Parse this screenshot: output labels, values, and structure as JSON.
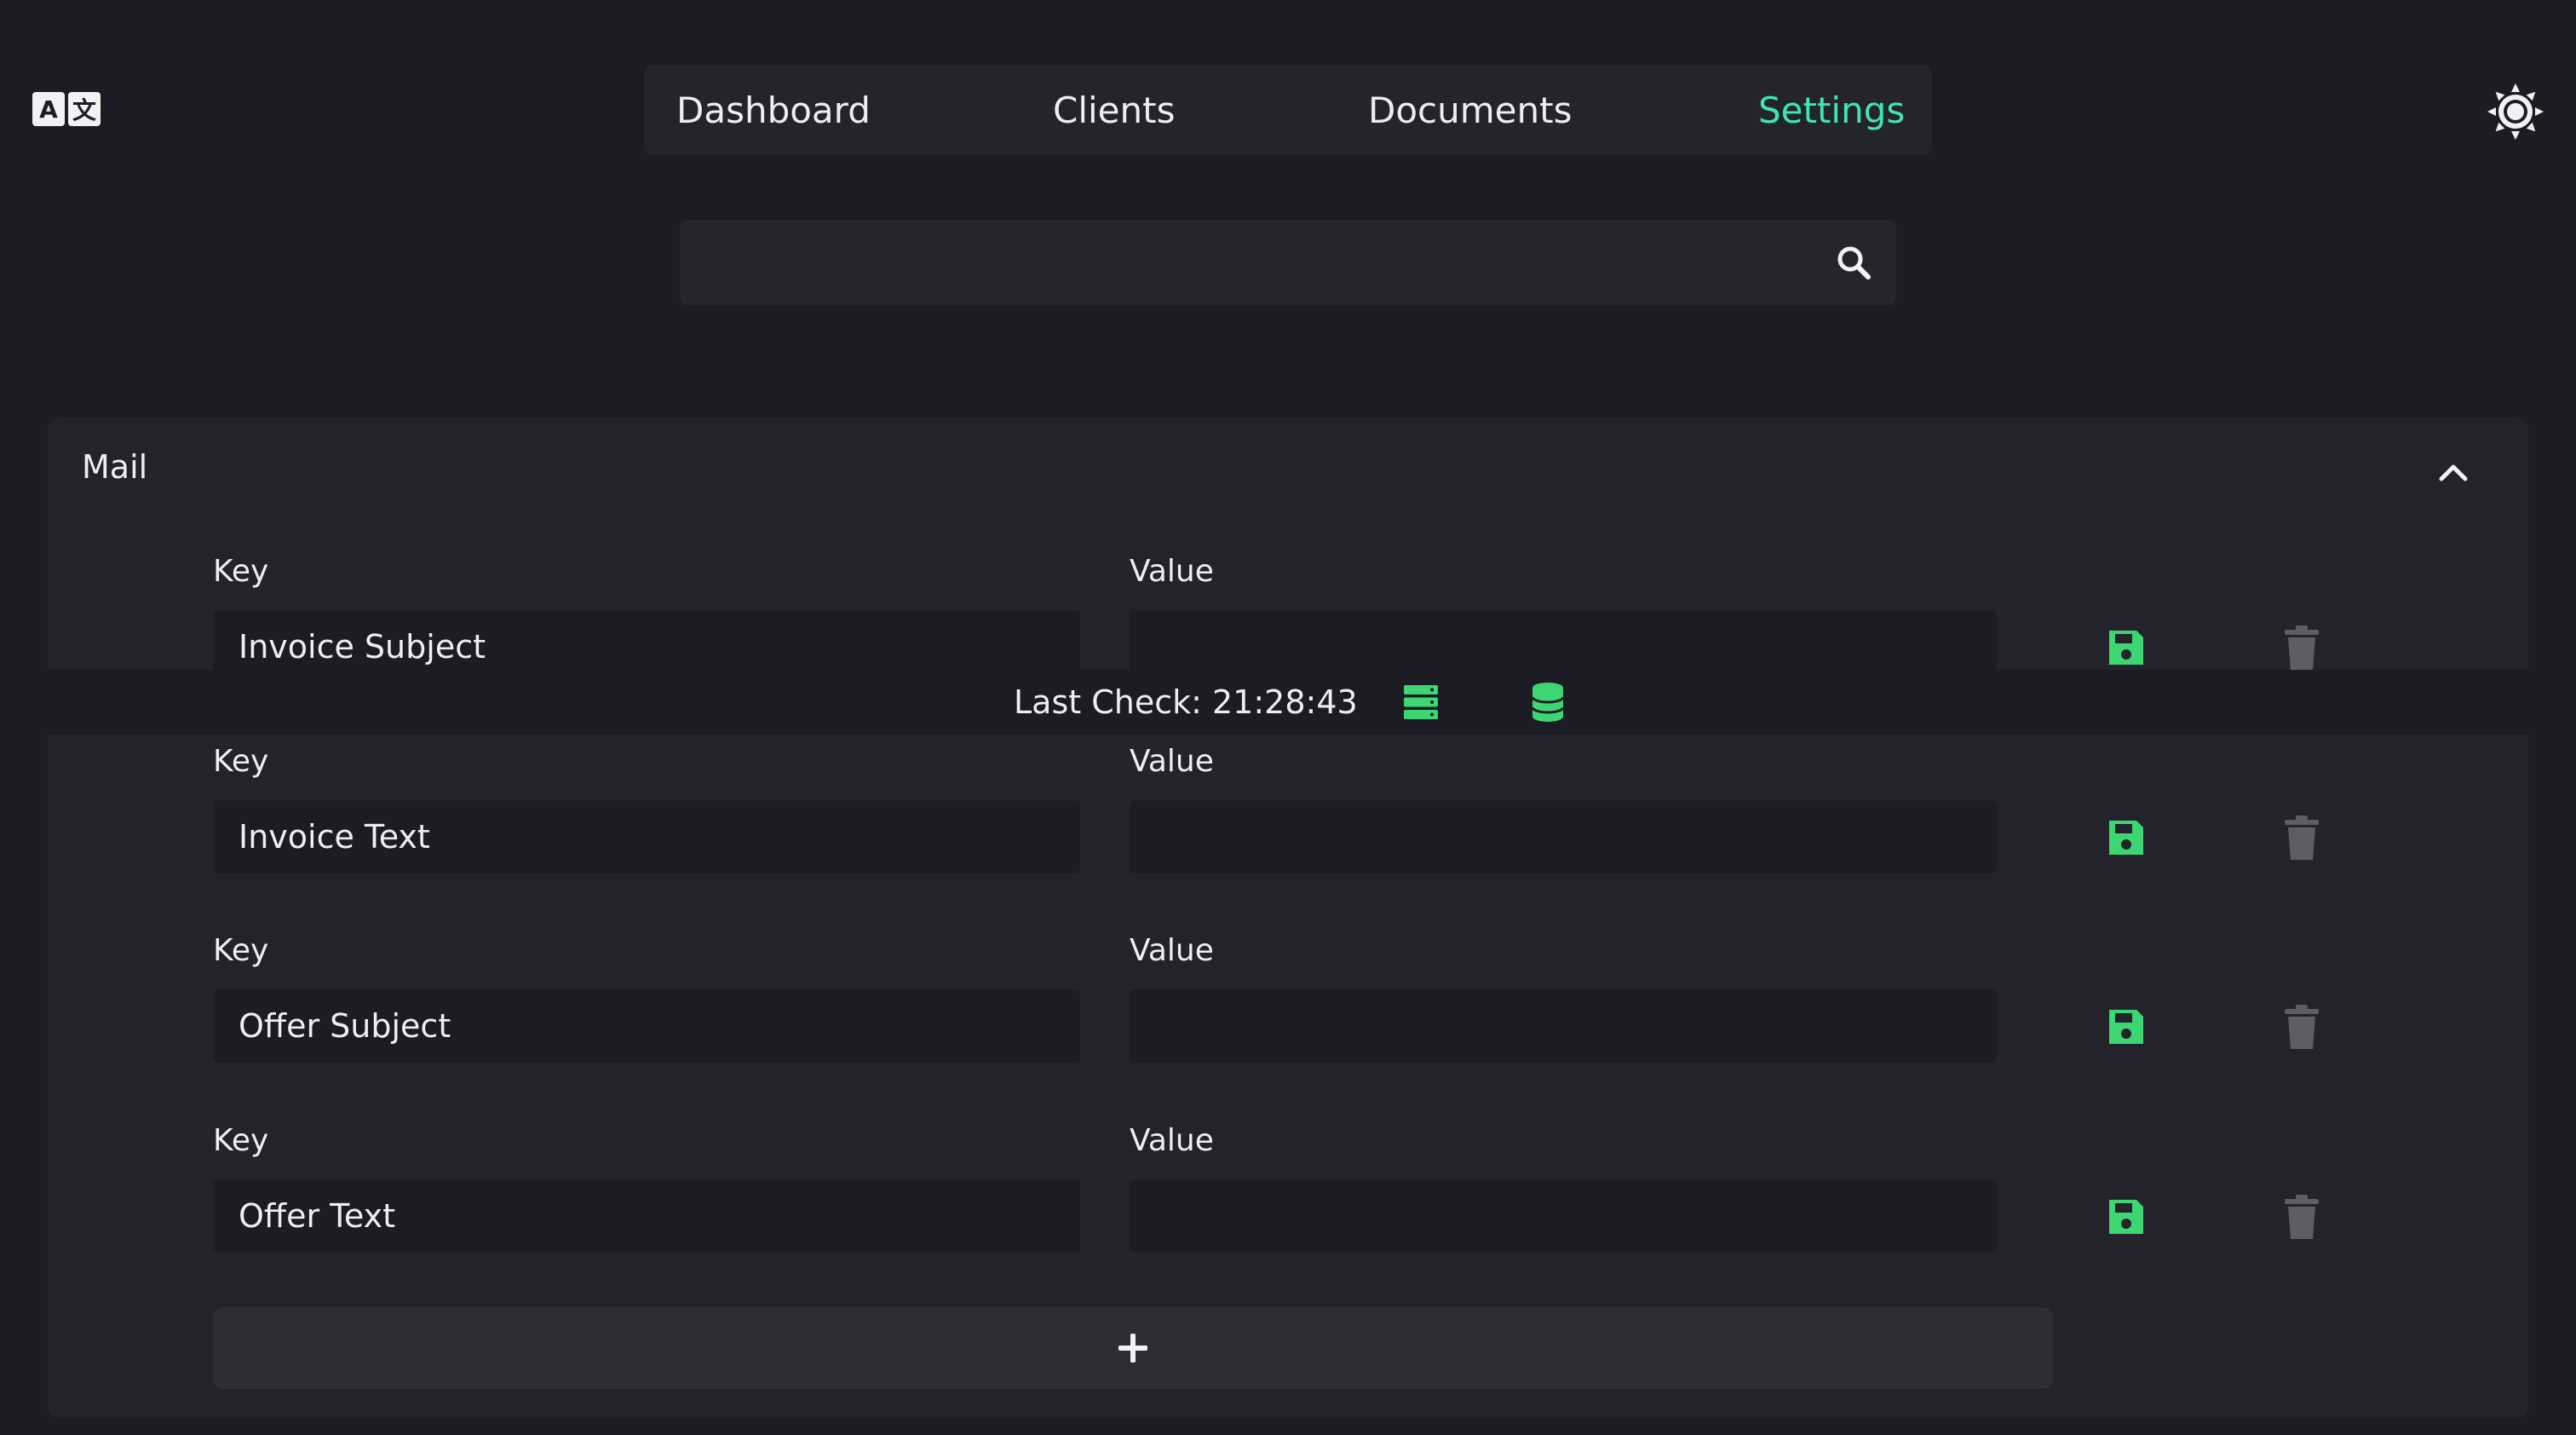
{
  "header": {
    "language_toggle": {
      "latin_glyph": "A",
      "cjk_glyph": "文",
      "icon": "translate-icon"
    },
    "nav": [
      {
        "label": "Dashboard",
        "active": false
      },
      {
        "label": "Clients",
        "active": false
      },
      {
        "label": "Documents",
        "active": false
      },
      {
        "label": "Settings",
        "active": true
      }
    ],
    "theme_toggle_icon": "sun-icon"
  },
  "search": {
    "value": "",
    "placeholder": "",
    "icon": "search-icon"
  },
  "panel": {
    "title": "Mail",
    "collapse_icon": "chevron-up-icon",
    "key_label": "Key",
    "value_label": "Value",
    "rows": [
      {
        "key": "Invoice Subject",
        "value": ""
      },
      {
        "key": "Invoice Text",
        "value": ""
      },
      {
        "key": "Offer Subject",
        "value": ""
      },
      {
        "key": "Offer Text",
        "value": ""
      }
    ],
    "add_icon": "plus-icon"
  },
  "status": {
    "text": "Last Check: 21:28:43",
    "server_icon": "server-icon",
    "database_icon": "database-icon"
  },
  "colors": {
    "background": "#1b1c24",
    "surface": "#22232b",
    "accent": "#3ee6b4",
    "save_green": "#3dd672",
    "delete_gray": "#5c5d66"
  }
}
